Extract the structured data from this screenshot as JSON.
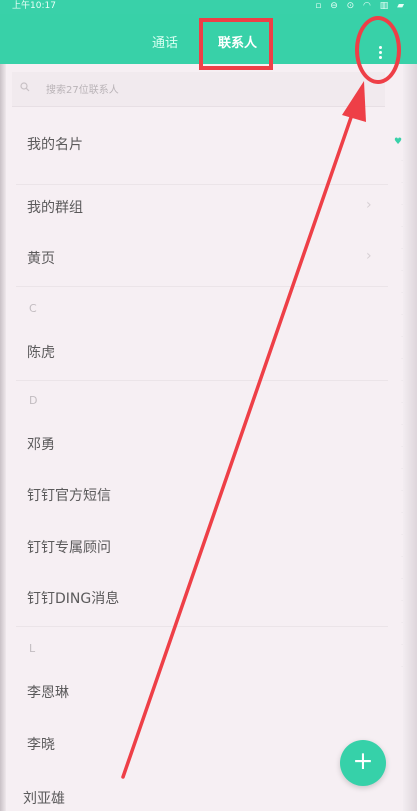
{
  "status": {
    "time": "上午10:17",
    "icons": "▫ ⊖ ⊙ ◠ ▥ ▰"
  },
  "tabs": {
    "calls": "通话",
    "contacts": "联系人"
  },
  "search": {
    "placeholder": "搜索27位联系人"
  },
  "items": {
    "my_card": "我的名片",
    "my_groups": "我的群组",
    "yellow_pages": "黄页",
    "section_c": "C",
    "chen_hu": "陈虎",
    "section_d": "D",
    "deng_yong": "邓勇",
    "dingding_sms": "钉钉官方短信",
    "dingding_advisor": "钉钉专属顾问",
    "dingding_ding": "钉钉DING消息",
    "section_l": "L",
    "li_enlin": "李恩琳",
    "li_xiao": "李晓",
    "liu_yaxiong": "刘亚雄"
  },
  "chevron": "›",
  "heart": "♥",
  "fab": {
    "symbol": "+"
  },
  "colors": {
    "accent": "#38d1a8",
    "annotation_red": "#ee3f47",
    "text": "#5b5a5b"
  }
}
